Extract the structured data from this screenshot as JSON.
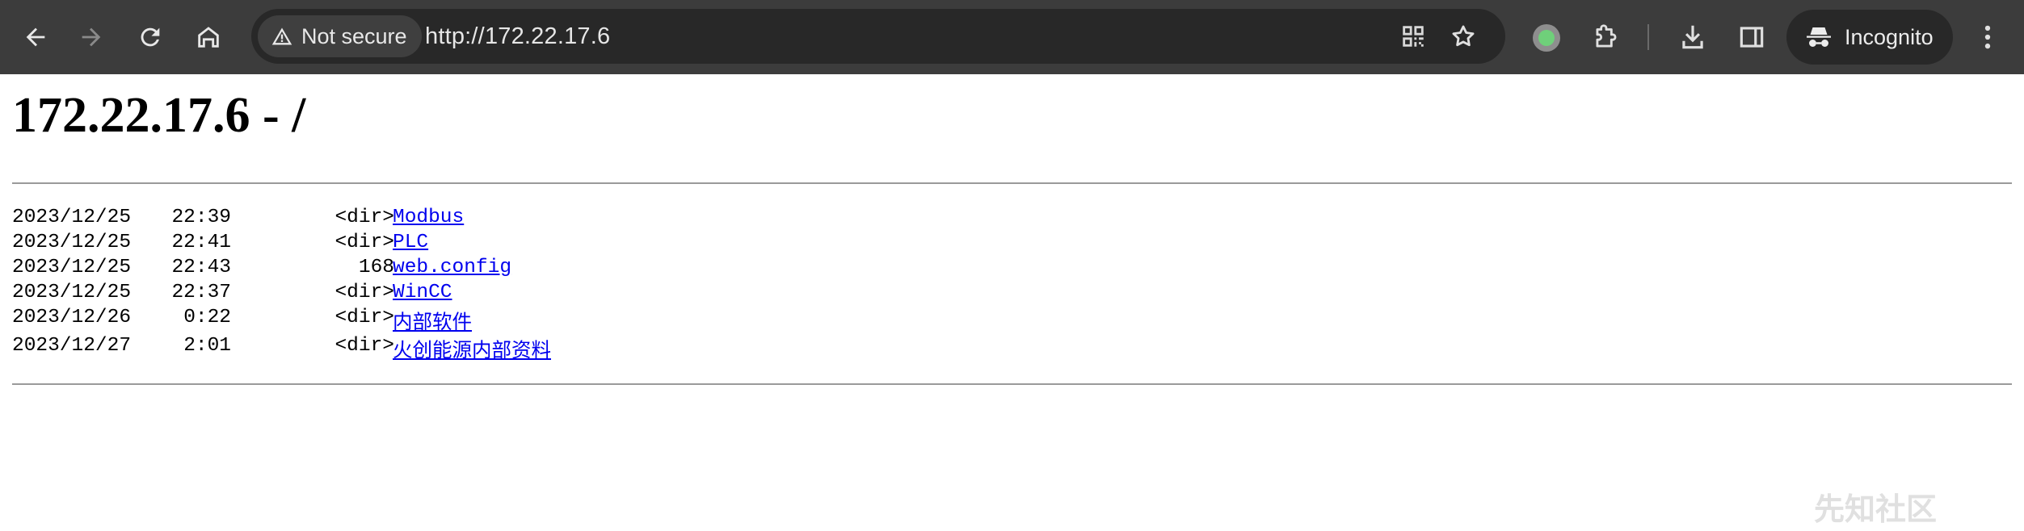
{
  "browser": {
    "security_label": "Not secure",
    "url": "http://172.22.17.6",
    "incognito_label": "Incognito",
    "icons": [
      "back-arrow-icon",
      "forward-arrow-icon",
      "reload-icon",
      "home-icon",
      "warning-icon",
      "qr-code-icon",
      "bookmark-star-icon",
      "profile-icon",
      "extensions-icon",
      "download-icon",
      "side-panel-icon",
      "incognito-icon",
      "more-menu-icon"
    ]
  },
  "page": {
    "title": "172.22.17.6 - /",
    "entries": [
      {
        "date": "2023/12/25",
        "time": "22:39",
        "size": "<dir>",
        "name": "Modbus"
      },
      {
        "date": "2023/12/25",
        "time": "22:41",
        "size": "<dir>",
        "name": "PLC"
      },
      {
        "date": "2023/12/25",
        "time": "22:43",
        "size": "168",
        "name": "web.config"
      },
      {
        "date": "2023/12/25",
        "time": "22:37",
        "size": "<dir>",
        "name": "WinCC"
      },
      {
        "date": "2023/12/26",
        "time": "0:22",
        "size": "<dir>",
        "name": "内部软件"
      },
      {
        "date": "2023/12/27",
        "time": "2:01",
        "size": "<dir>",
        "name": "火创能源内部资料"
      }
    ]
  },
  "watermark": "先知社区",
  "colors": {
    "toolbar": "#3c3c3c",
    "omnibox": "#282828",
    "link": "#0000ee"
  }
}
